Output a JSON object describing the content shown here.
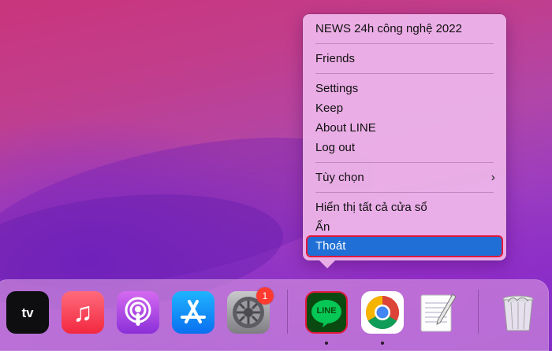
{
  "context_menu": {
    "items": [
      {
        "label": "NEWS 24h công nghệ 2022"
      },
      {
        "label": "Friends"
      },
      {
        "label": "Settings"
      },
      {
        "label": "Keep"
      },
      {
        "label": "About LINE"
      },
      {
        "label": "Log out"
      },
      {
        "label": "Tùy chọn",
        "submenu_glyph": "›"
      },
      {
        "label": "Hiển thị tất cả cửa sổ"
      },
      {
        "label": "Ẩn"
      },
      {
        "label": "Thoát",
        "selected": true
      }
    ]
  },
  "dock": {
    "apps": [
      {
        "name": "Apple TV",
        "icon_text": "tv"
      },
      {
        "name": "Music",
        "icon_glyph": "♫"
      },
      {
        "name": "Podcasts"
      },
      {
        "name": "App Store"
      },
      {
        "name": "System Preferences",
        "badge": "1"
      },
      {
        "name": "LINE",
        "icon_text": "LINE",
        "running": true,
        "highlighted": true
      },
      {
        "name": "Google Chrome",
        "running": true
      },
      {
        "name": "TextEdit"
      },
      {
        "name": "Trash"
      }
    ]
  },
  "colors": {
    "menu_selection": "#1f6fd6",
    "highlight_border": "#e0183a",
    "badge": "#ff3b30",
    "line_green": "#06c755"
  }
}
